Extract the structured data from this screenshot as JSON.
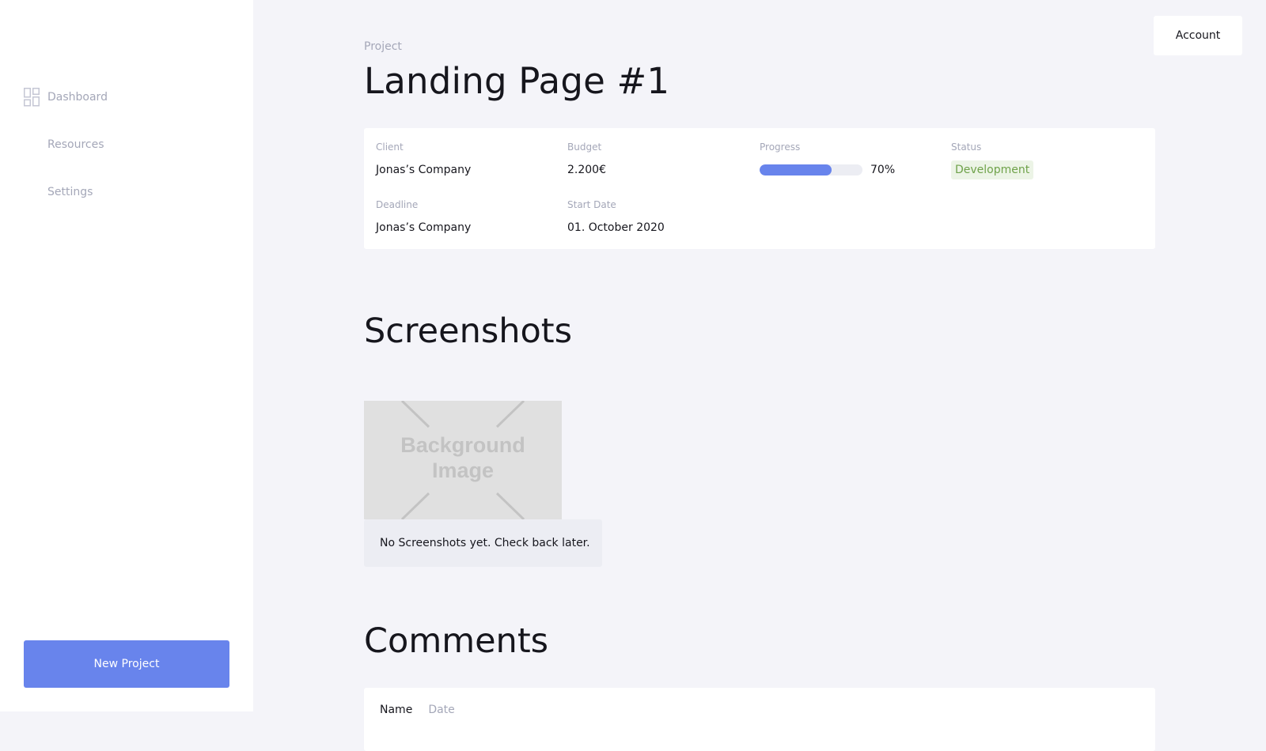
{
  "sidebar": {
    "items": [
      {
        "label": "Dashboard",
        "icon": "dashboard-icon"
      },
      {
        "label": "Resources"
      },
      {
        "label": "Settings"
      }
    ],
    "new_project_label": "New Project"
  },
  "header": {
    "account_label": "Account"
  },
  "project": {
    "breadcrumb": "Project",
    "title": "Landing Page #1",
    "fields": {
      "client": {
        "label": "Client",
        "value": "Jonas’s Company"
      },
      "budget": {
        "label": "Budget",
        "value": "2.200€"
      },
      "progress": {
        "label": "Progress",
        "value_text": "70%",
        "value": 70
      },
      "status": {
        "label": "Status",
        "value": "Development"
      },
      "deadline": {
        "label": "Deadline",
        "value": "Jonas’s Company"
      },
      "start_date": {
        "label": "Start Date",
        "value": "01. October 2020"
      }
    }
  },
  "screenshots": {
    "title": "Screenshots",
    "placeholder_text": "Background\nImage",
    "empty_message": "No Screenshots yet. Check back later."
  },
  "comments": {
    "title": "Comments",
    "columns": [
      "Name",
      "Date"
    ]
  },
  "colors": {
    "accent": "#6884ec",
    "status_green": "#6fa24a",
    "muted_text": "#a4a7b8"
  }
}
